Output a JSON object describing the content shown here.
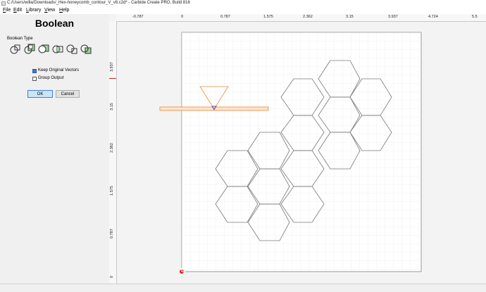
{
  "window": {
    "title": "C:/Users/willa/Downloads/_Hex-honeycomb_contour_V_v8.c2d* - Carbide Create PRO, Build 816"
  },
  "menu": [
    {
      "label": "File"
    },
    {
      "label": "Edit"
    },
    {
      "label": "Library"
    },
    {
      "label": "View"
    },
    {
      "label": "Help"
    }
  ],
  "panel": {
    "heading": "Boolean",
    "section_label": "Boolean Type",
    "options": [
      {
        "icon": "boolean-union-icon"
      },
      {
        "icon": "boolean-union-outline-icon"
      },
      {
        "icon": "boolean-subtract-icon"
      },
      {
        "icon": "boolean-intersect-icon"
      },
      {
        "icon": "boolean-split-icon"
      },
      {
        "icon": "boolean-difference-icon"
      }
    ],
    "keep_original": {
      "label": "Keep Original Vectors",
      "checked": true
    },
    "group_output": {
      "label": "Group Output",
      "checked": false
    },
    "ok_label": "OK",
    "cancel_label": "Cancel"
  },
  "ruler": {
    "x_labels": [
      "-0.787",
      "0",
      "0.787",
      "1.575",
      "2.362",
      "3.15",
      "3.937",
      "4.724",
      "5.5"
    ],
    "y_labels": [
      "3.937",
      "3.15",
      "2.362",
      "1.575",
      "0.787",
      "0"
    ]
  },
  "colors": {
    "selection": "#e88a3a",
    "hex_outline": "#777777",
    "origin_marker": "#d42020",
    "accent": "#3a78d6"
  }
}
